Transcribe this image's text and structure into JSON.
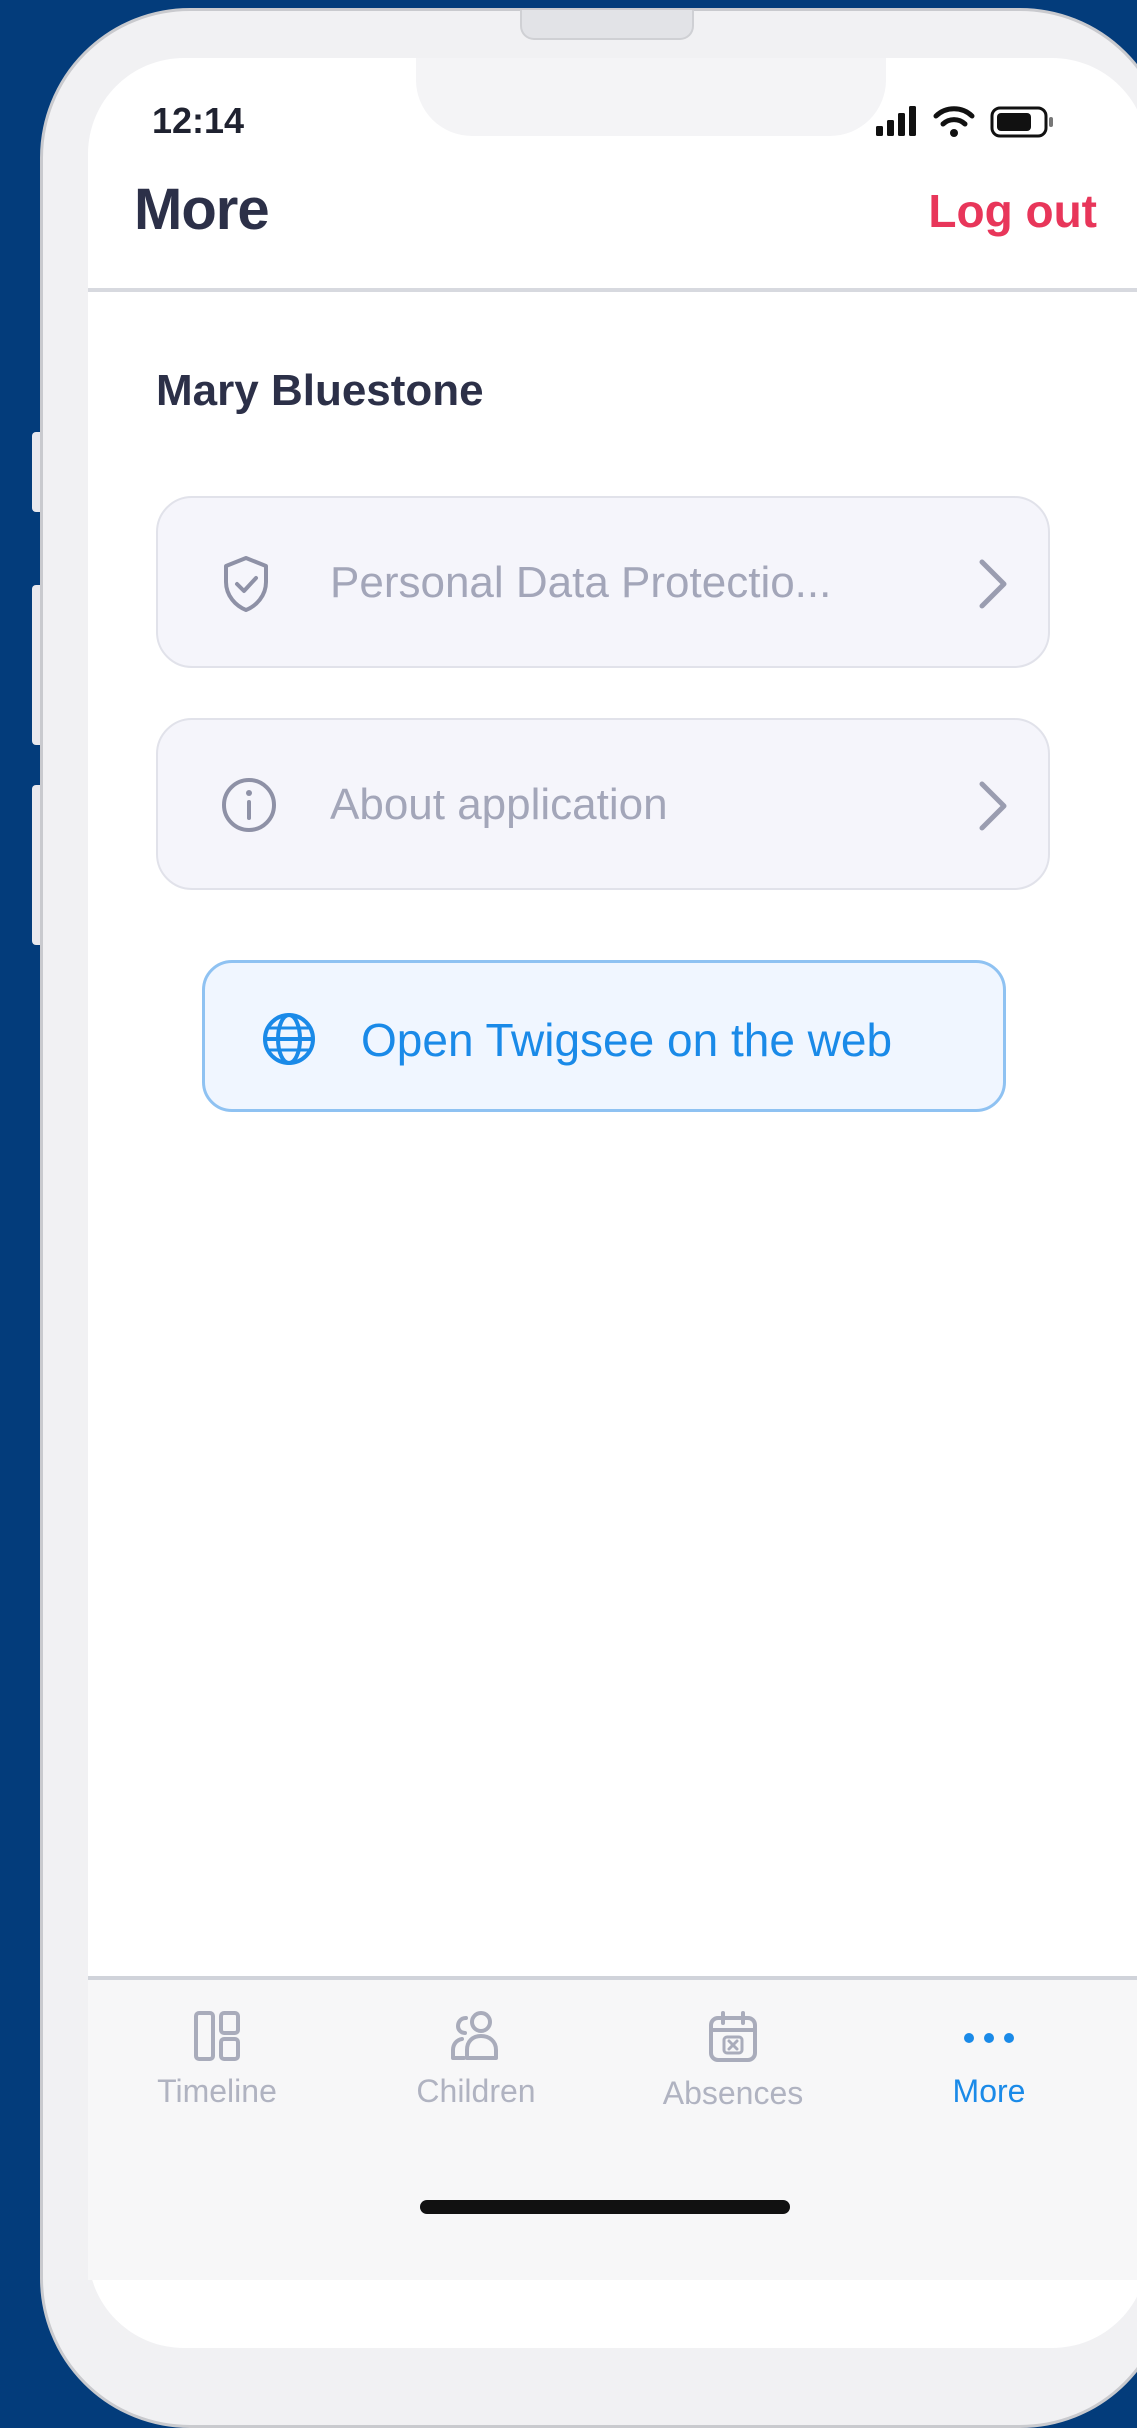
{
  "status_bar": {
    "time": "12:14"
  },
  "header": {
    "title": "More",
    "logout_label": "Log out"
  },
  "user": {
    "name": "Mary Bluestone"
  },
  "menu": {
    "items": [
      {
        "label": "Personal Data Protectio...",
        "icon": "shield-check-icon"
      },
      {
        "label": "About application",
        "icon": "info-icon"
      }
    ]
  },
  "web_button": {
    "label": "Open Twigsee on the web",
    "icon": "globe-icon"
  },
  "tabs": [
    {
      "label": "Timeline",
      "icon": "timeline-icon",
      "active": false
    },
    {
      "label": "Children",
      "icon": "children-icon",
      "active": false
    },
    {
      "label": "Absences",
      "icon": "calendar-x-icon",
      "active": false
    },
    {
      "label": "More",
      "icon": "more-dots-icon",
      "active": true
    }
  ],
  "colors": {
    "background": "#033c7b",
    "accent": "#1a8ae8",
    "logout": "#e8365a",
    "title": "#2c3048",
    "muted": "#a3a6b9"
  }
}
